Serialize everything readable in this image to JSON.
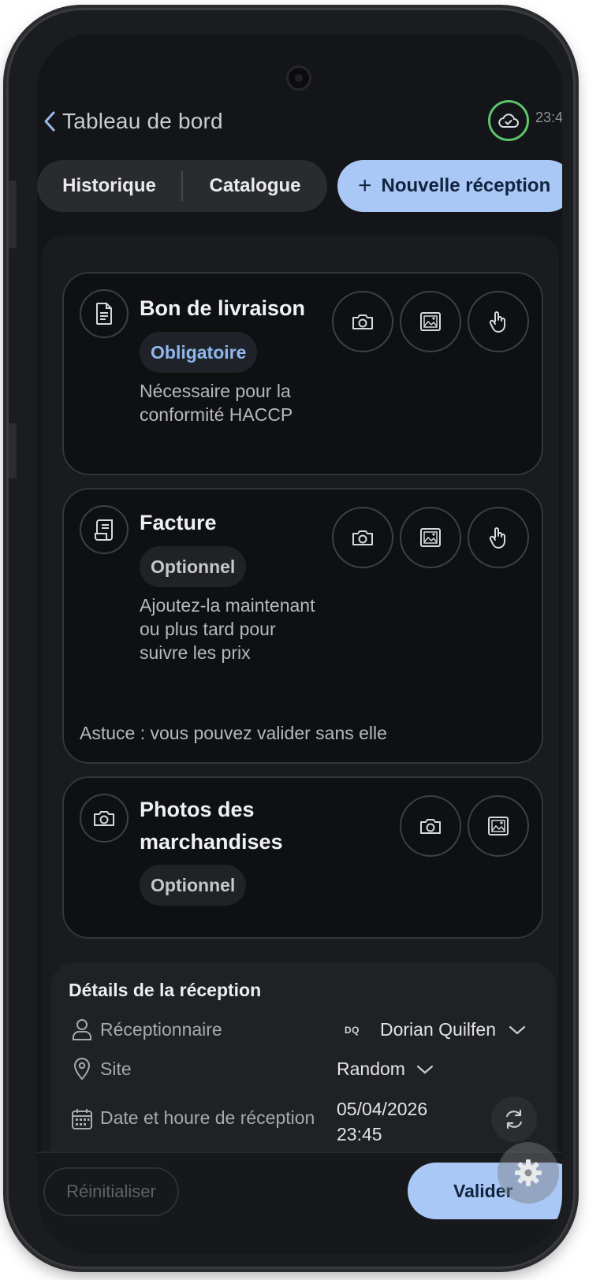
{
  "header": {
    "back_label": "Tableau de bord",
    "clock": "23:4",
    "sync_status_color": "#5cc46a"
  },
  "tabs": {
    "history": "Historique",
    "catalog": "Catalogue",
    "new_reception": "Nouvelle réception",
    "new_reception_icon": "plus-icon"
  },
  "cards": [
    {
      "title": "Bon de livraison",
      "badge": "Obligatoire",
      "description": "Nécessaire pour la conformité HACCP",
      "icon": "document-icon",
      "actions": [
        "camera-icon",
        "gallery-icon",
        "tap-hand-icon"
      ]
    },
    {
      "title": "Facture",
      "badge": "Optionnel",
      "description": "Ajoutez-la maintenant ou plus tard pour suivre les prix",
      "tip": "Astuce : vous pouvez valider sans elle",
      "icon": "receipt-icon",
      "actions": [
        "camera-icon",
        "gallery-icon",
        "tap-hand-icon"
      ]
    },
    {
      "title": "Photos des marchandises",
      "badge": "Optionnel",
      "icon": "camera-icon",
      "actions": [
        "camera-icon",
        "gallery-icon"
      ]
    }
  ],
  "details": {
    "title": "Détails de la réception",
    "receiver_label": "Réceptionnaire",
    "receiver_initials": "DQ",
    "receiver_value": "Dorian Quilfen",
    "site_label": "Site",
    "site_value": "Random",
    "date_label": "Date et houre de réception",
    "date_value": "05/04/2026",
    "time_value": "23:45"
  },
  "footer": {
    "reset": "Réinitialiser",
    "validate": "Valider"
  },
  "colors": {
    "accent": "#a9c8f5",
    "required_badge": "#8fb7ee",
    "background": "#141518"
  }
}
